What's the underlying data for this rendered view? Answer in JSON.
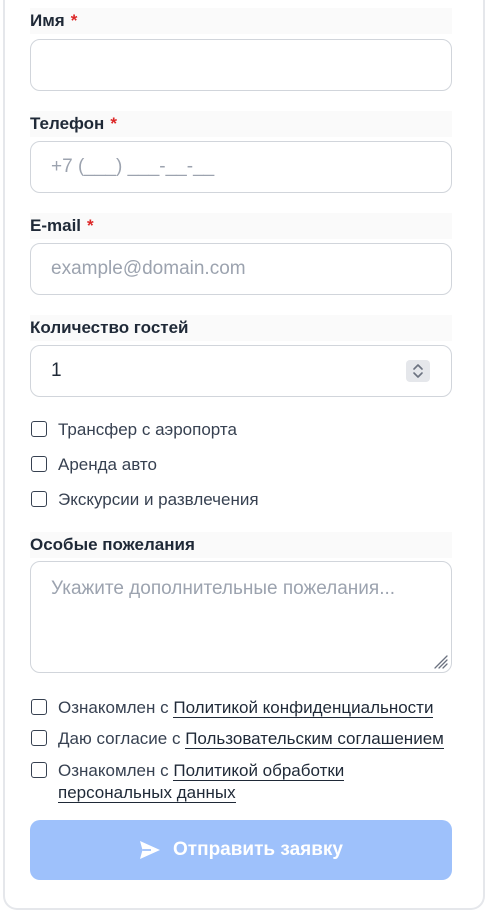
{
  "form": {
    "name": {
      "label": "Имя",
      "required_mark": "*",
      "value": ""
    },
    "phone": {
      "label": "Телефон",
      "required_mark": "*",
      "placeholder": "+7 (___) ___-__-__"
    },
    "email": {
      "label": "E-mail",
      "required_mark": "*",
      "placeholder": "example@domain.com"
    },
    "guests": {
      "label": "Количество гостей",
      "value": "1"
    },
    "services": [
      {
        "label": "Трансфер с аэропорта",
        "checked": false
      },
      {
        "label": "Аренда авто",
        "checked": false
      },
      {
        "label": "Экскурсии и развлечения",
        "checked": false
      }
    ],
    "wishes": {
      "label": "Особые пожелания",
      "placeholder": "Укажите дополнительные пожелания..."
    },
    "consents": [
      {
        "prefix": "Ознакомлен с",
        "link": "Политикой конфиденциальности",
        "checked": false
      },
      {
        "prefix": "Даю согласие с",
        "link": "Пользовательским соглашением",
        "checked": false
      },
      {
        "prefix": "Ознакомлен с",
        "link": "Политикой обработки",
        "link_line2": "персональных данных",
        "checked": false
      }
    ],
    "submit_label": "Отправить заявку"
  },
  "colors": {
    "required": "#dc2626",
    "submit_background": "#9ec1fb"
  },
  "icons": {
    "submit": "send-icon",
    "stepper": "stepper-icon",
    "resize": "resize-handle-icon"
  }
}
